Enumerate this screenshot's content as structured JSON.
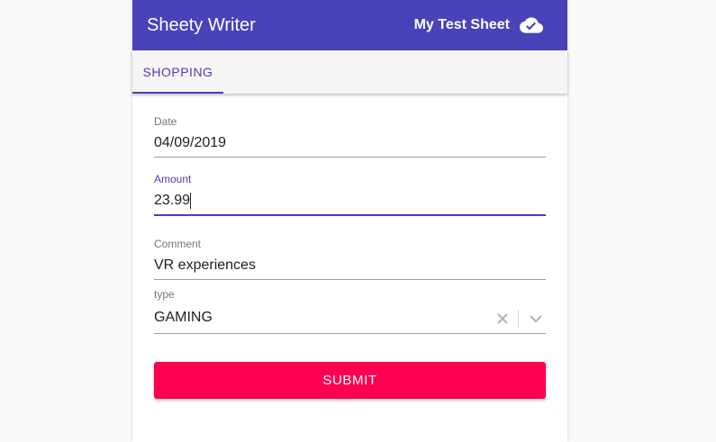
{
  "app": {
    "title": "Sheety Writer",
    "sheet_name": "My Test Sheet",
    "sync_icon": "cloud-done-icon"
  },
  "tabs": [
    {
      "label": "SHOPPING",
      "active": true
    }
  ],
  "form": {
    "date": {
      "label": "Date",
      "value": "04/09/2019"
    },
    "amount": {
      "label": "Amount",
      "value": "23.99"
    },
    "comment": {
      "label": "Comment",
      "value": "VR experiences"
    },
    "type": {
      "label": "type",
      "value": "GAMING"
    },
    "submit_label": "SUBMIT"
  },
  "colors": {
    "primary": "#4a42b9",
    "accent": "#ff0050"
  }
}
